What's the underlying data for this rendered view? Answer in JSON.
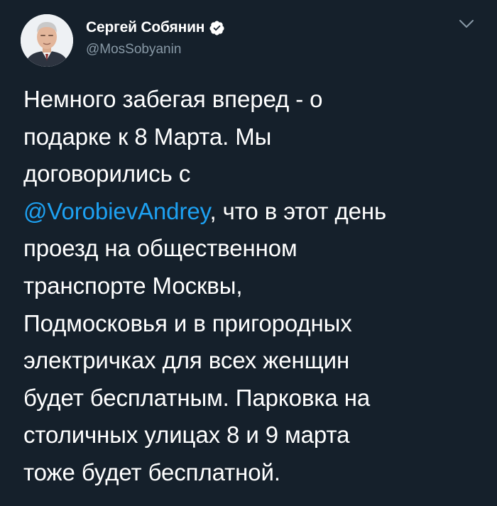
{
  "author": {
    "display_name": "Сергей Собянин",
    "handle": "@MosSobyanin",
    "verified": true,
    "avatar_icon": "profile-photo",
    "verified_icon": "verified-badge-icon"
  },
  "menu": {
    "icon": "chevron-down-icon"
  },
  "tweet": {
    "lines": [
      "Немного забегая вперед - о",
      "подарке к 8 Марта. Мы",
      "договорились с"
    ],
    "mention": "@VorobievAndrey",
    "mention_tail": ", что в этот день",
    "lines_after": [
      "проезд на общественном",
      "транспорте Москвы,",
      "Подмосковья и в пригородных",
      "электричках для всех женщин",
      "будет бесплатным. Парковка на",
      "столичных улицах 8 и 9 марта",
      "тоже будет бесплатной."
    ]
  },
  "colors": {
    "background": "#15202b",
    "text": "#ffffff",
    "secondary": "#8899a6",
    "link": "#1da1f2"
  }
}
